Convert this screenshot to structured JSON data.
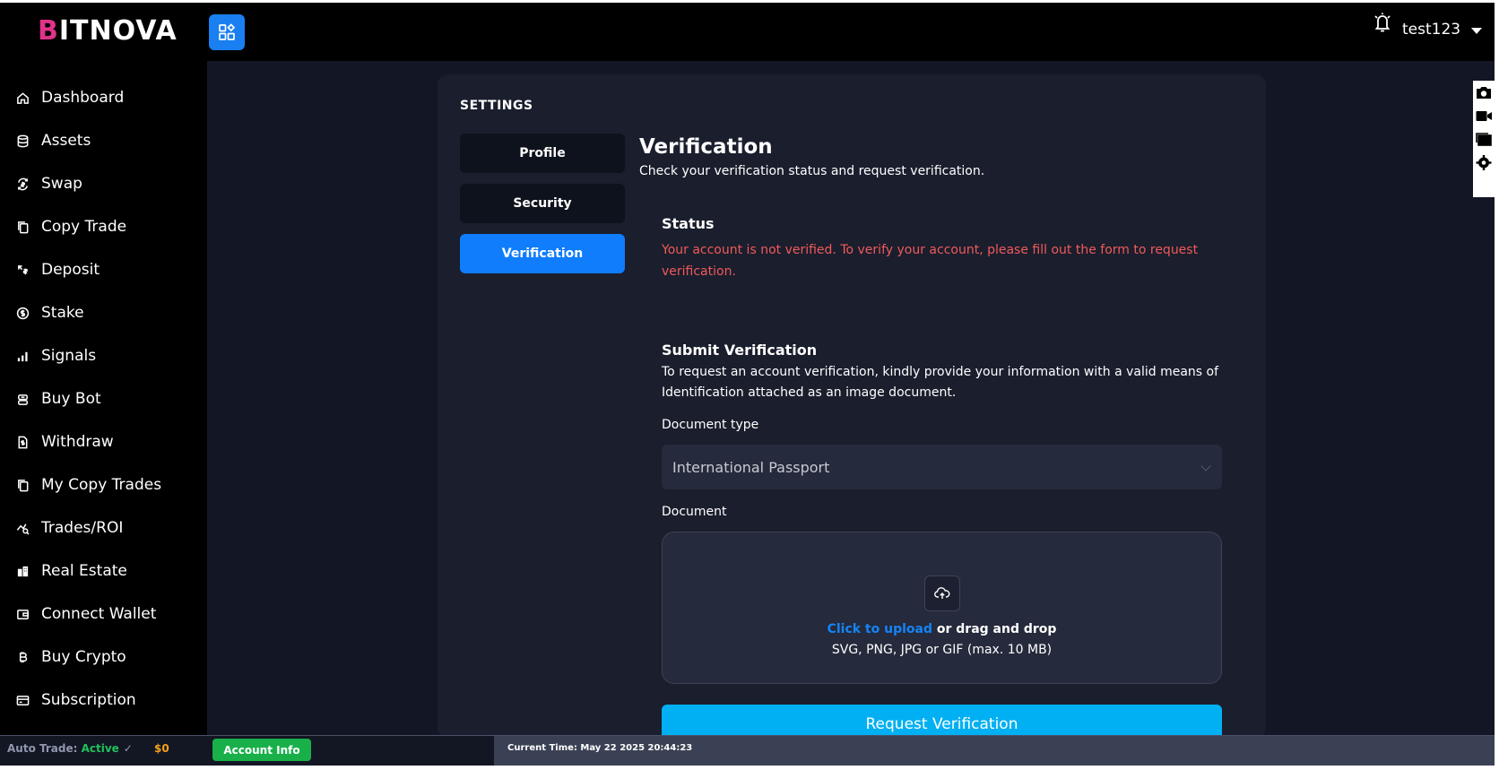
{
  "brand": {
    "logo_first": "B",
    "logo_rest": "ITNOVA"
  },
  "sidebar": {
    "items": [
      {
        "label": "Dashboard",
        "icon": "home-icon"
      },
      {
        "label": "Assets",
        "icon": "database-icon"
      },
      {
        "label": "Swap",
        "icon": "swap-icon"
      },
      {
        "label": "Copy Trade",
        "icon": "copy-icon"
      },
      {
        "label": "Deposit",
        "icon": "deposit-icon"
      },
      {
        "label": "Stake",
        "icon": "dollar-circle-icon"
      },
      {
        "label": "Signals",
        "icon": "signal-bars-icon"
      },
      {
        "label": "Buy Bot",
        "icon": "bot-icon"
      },
      {
        "label": "Withdraw",
        "icon": "withdraw-doc-icon"
      },
      {
        "label": "My Copy Trades",
        "icon": "copy-icon"
      },
      {
        "label": "Trades/ROI",
        "icon": "trend-icon"
      },
      {
        "label": "Real Estate",
        "icon": "building-icon"
      },
      {
        "label": "Connect Wallet",
        "icon": "wallet-icon"
      },
      {
        "label": "Buy Crypto",
        "icon": "bitcoin-icon"
      },
      {
        "label": "Subscription",
        "icon": "card-icon"
      }
    ]
  },
  "topbar": {
    "username": "test123"
  },
  "settings": {
    "label": "SETTINGS",
    "tabs": [
      {
        "label": "Profile",
        "active": false
      },
      {
        "label": "Security",
        "active": false
      },
      {
        "label": "Verification",
        "active": true
      }
    ]
  },
  "verification": {
    "title": "Verification",
    "subtitle": "Check your verification status and request verification.",
    "status_heading": "Status",
    "status_message": "Your account is not verified. To verify your account, please fill out the form to request verification.",
    "submit_heading": "Submit Verification",
    "submit_desc": "To request an account verification, kindly provide your information with a valid means of Identification attached as an image document.",
    "doc_type_label": "Document type",
    "doc_type_value": "International Passport",
    "document_label": "Document",
    "upload_link": "Click to upload",
    "upload_rest": " or drag and drop",
    "upload_hint": "SVG, PNG, JPG or GIF (max. 10 MB)",
    "request_button": "Request Verification"
  },
  "footer": {
    "auto_label": "Auto Trade: ",
    "auto_status": "Active",
    "amount": "$0",
    "account_button": "Account Info",
    "time": "Current Time: May 22 2025 20:44:23"
  },
  "colors": {
    "accent": "#0f7dfc",
    "request": "#01b0f2",
    "error": "#f05a5a",
    "success": "#19b04a",
    "amount": "#f7a21b"
  }
}
